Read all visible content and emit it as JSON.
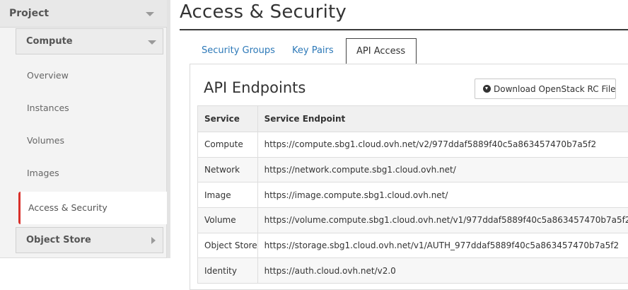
{
  "sidebar": {
    "project_label": "Project",
    "compute_label": "Compute",
    "items": [
      {
        "label": "Overview"
      },
      {
        "label": "Instances"
      },
      {
        "label": "Volumes"
      },
      {
        "label": "Images"
      },
      {
        "label": "Access & Security",
        "active": true
      }
    ],
    "object_store_label": "Object Store"
  },
  "page": {
    "title": "Access & Security"
  },
  "tabs": [
    {
      "label": "Security Groups"
    },
    {
      "label": "Key Pairs"
    },
    {
      "label": "API Access",
      "active": true
    }
  ],
  "panel": {
    "title": "API Endpoints",
    "download_label": "Download OpenStack RC File",
    "download_icon": "download-circle-icon"
  },
  "table": {
    "headers": [
      "Service",
      "Service Endpoint"
    ],
    "rows": [
      [
        "Compute",
        "https://compute.sbg1.cloud.ovh.net/v2/977ddaf5889f40c5a863457470b7a5f2"
      ],
      [
        "Network",
        "https://network.compute.sbg1.cloud.ovh.net/"
      ],
      [
        "Image",
        "https://image.compute.sbg1.cloud.ovh.net/"
      ],
      [
        "Volume",
        "https://volume.compute.sbg1.cloud.ovh.net/v1/977ddaf5889f40c5a863457470b7a5f2"
      ],
      [
        "Object Store",
        "https://storage.sbg1.cloud.ovh.net/v1/AUTH_977ddaf5889f40c5a863457470b7a5f2"
      ],
      [
        "Identity",
        "https://auth.cloud.ovh.net/v2.0"
      ]
    ]
  },
  "colors": {
    "link": "#2d79b8",
    "active_marker": "#d9302a"
  }
}
